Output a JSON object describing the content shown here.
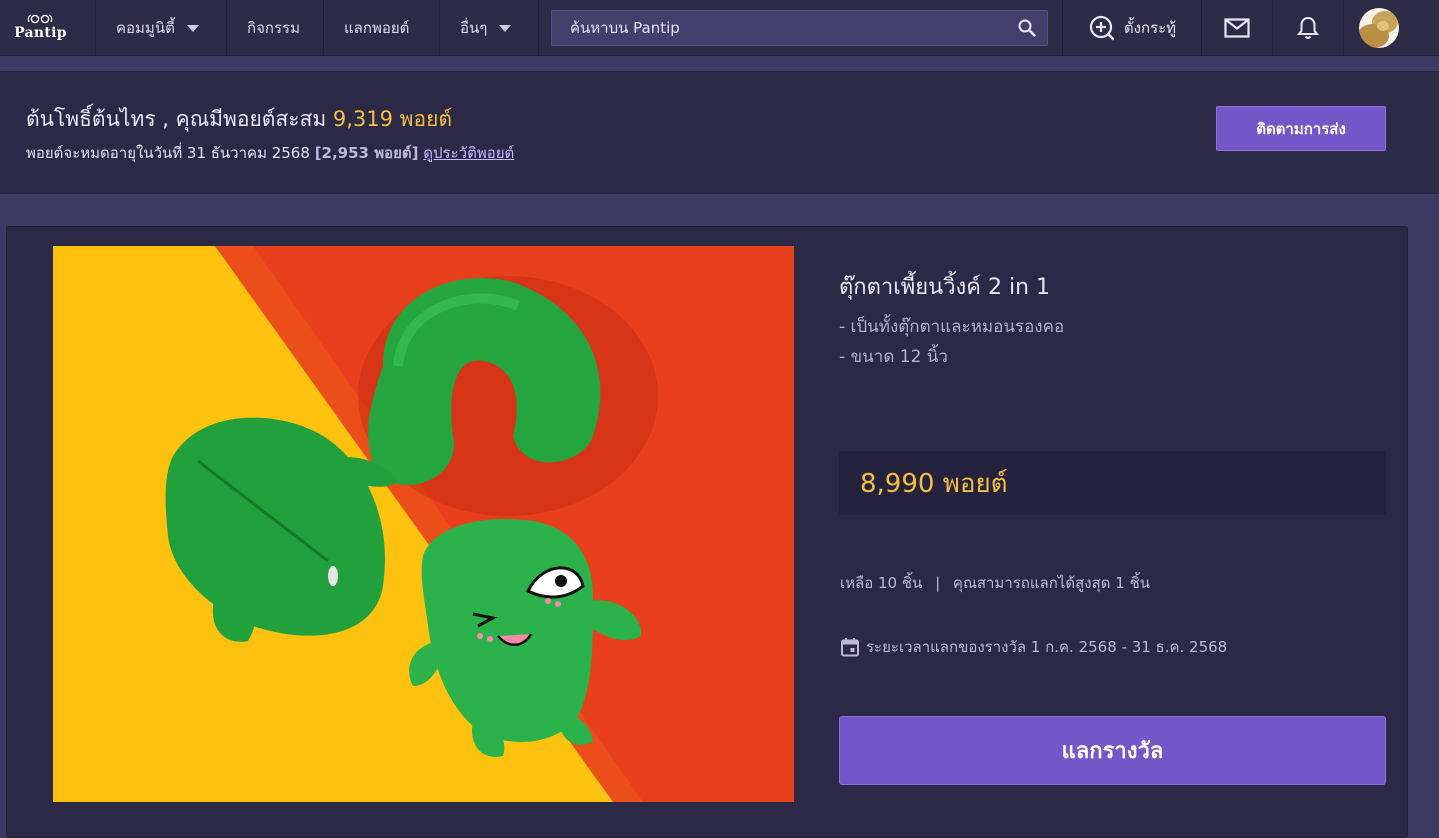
{
  "nav": {
    "logo_text": "Pantip",
    "community_label": "คอมมูนิตี้",
    "activity_label": "กิจกรรม",
    "points_label": "แลกพอยต์",
    "more_label": "อื่นๆ",
    "search_placeholder": "ค้นหาบน Pantip",
    "new_post_label": "ตั้งกระทู้",
    "icons": [
      "pantip-logo-icon",
      "chevron-down-icon",
      "search-icon",
      "add-circle-icon",
      "mail-icon",
      "bell-icon",
      "avatar"
    ]
  },
  "points": {
    "username": "ต้นโพธิ์ต้นไทร",
    "greeting_suffix": ", คุณมีพอยต์สะสม",
    "total": "9,319 พอยต์",
    "expire_text": "พอยต์จะหมดอายุในวันที่ 31 ธันวาคม 2568",
    "expire_amount": "[2,953 พอยต์]",
    "history_link": "ดูประวัติพอยต์",
    "track_button": "ติดตามการส่ง"
  },
  "reward": {
    "title": "ตุ๊กตาเพี้ยนวิ้งค์ 2 in 1",
    "desc_1": "- เป็นทั้งตุ๊กตาและหมอนรองคอ",
    "desc_2": "- ขนาด 12 นิ้ว",
    "price": "8,990 พอยต์",
    "remaining": "เหลือ 10 ชิ้น",
    "separator": "|",
    "limit": "คุณสามารถแลกได้สูงสุด 1 ชิ้น",
    "period": "ระยะเวลาแลกของรางวัล 1 ก.ค. 2568 - 31 ธ.ค. 2568",
    "redeem_button": "แลกรางวัล",
    "image": "reward-photo"
  },
  "colors": {
    "accent": "#7356c8",
    "gold": "#f5bf3d",
    "nav_bg": "#2e2b47",
    "page_bg": "#3c3963"
  }
}
